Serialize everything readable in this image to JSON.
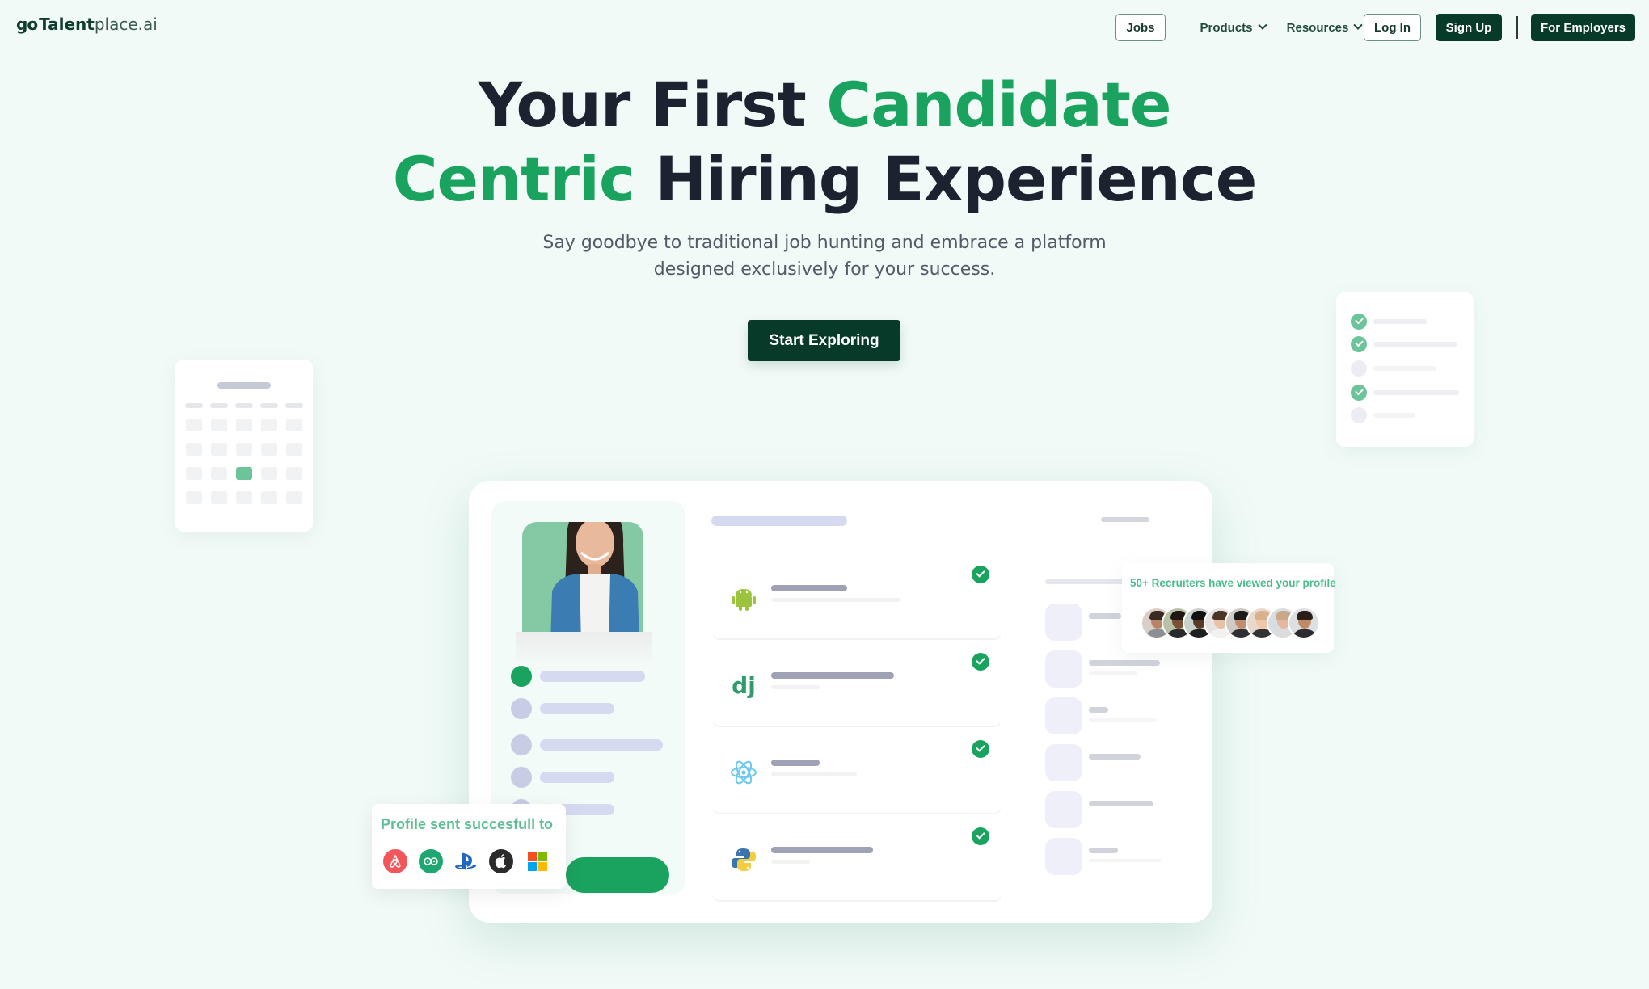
{
  "nav": {
    "logo": {
      "go": "go",
      "talent": "Talent",
      "place": "place.ai"
    },
    "jobs": "Jobs",
    "products": "Products",
    "resources": "Resources",
    "login": "Log In",
    "signup": "Sign Up",
    "employers": "For Employers"
  },
  "hero": {
    "line1_dark": "Your First ",
    "line1_green": "Candidate",
    "line2_green": "Centric",
    "line2_dark": " Hiring Experience",
    "subtitle_line1": "Say goodbye to traditional job hunting and embrace a platform",
    "subtitle_line2": "designed exclusively for your success.",
    "cta": "Start Exploring"
  },
  "colors": {
    "accent_green": "#1aa35f",
    "dark_green": "#083a29",
    "background": "#f1faf7"
  },
  "mockup": {
    "skills": [
      {
        "icon": "android-icon",
        "verified": true
      },
      {
        "icon": "django-icon",
        "glyph": "dj",
        "verified": true
      },
      {
        "icon": "react-icon",
        "verified": true
      },
      {
        "icon": "python-icon",
        "verified": true
      }
    ],
    "recruiters_text": "50+ Recruiters have viewed your profile",
    "recruiter_count_shown": 8,
    "profile_sent_text": "Profile sent succesfull to",
    "companies": [
      "airbnb-icon",
      "tripadvisor-icon",
      "playstation-icon",
      "apple-icon",
      "microsoft-icon"
    ]
  }
}
